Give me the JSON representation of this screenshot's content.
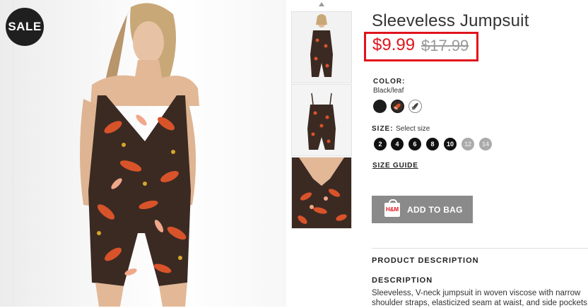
{
  "product": {
    "badge": "SALE",
    "title": "Sleeveless Jumpsuit",
    "sale_price": "$9.99",
    "original_price": "$17.99"
  },
  "color": {
    "label": "COLOR:",
    "value": "Black/leaf",
    "swatches": [
      "black",
      "black-leaf",
      "white-leaf"
    ]
  },
  "size": {
    "label": "SIZE:",
    "hint": "Select size",
    "options": [
      {
        "label": "2",
        "available": true
      },
      {
        "label": "4",
        "available": true
      },
      {
        "label": "6",
        "available": true
      },
      {
        "label": "8",
        "available": true
      },
      {
        "label": "10",
        "available": true
      },
      {
        "label": "12",
        "available": false
      },
      {
        "label": "14",
        "available": false
      }
    ],
    "guide": "SIZE GUIDE"
  },
  "cart": {
    "add_label": "ADD TO BAG",
    "bag_icon_text": "H&M"
  },
  "description": {
    "section_title": "PRODUCT DESCRIPTION",
    "heading": "DESCRIPTION",
    "line1": "Sleeveless, V-neck jumpsuit in woven viscose with narrow",
    "line2": "shoulder straps, elasticized seam at waist, and side pockets"
  },
  "colors": {
    "sale_red": "#e0141c",
    "button_gray": "#8a8a8a"
  }
}
